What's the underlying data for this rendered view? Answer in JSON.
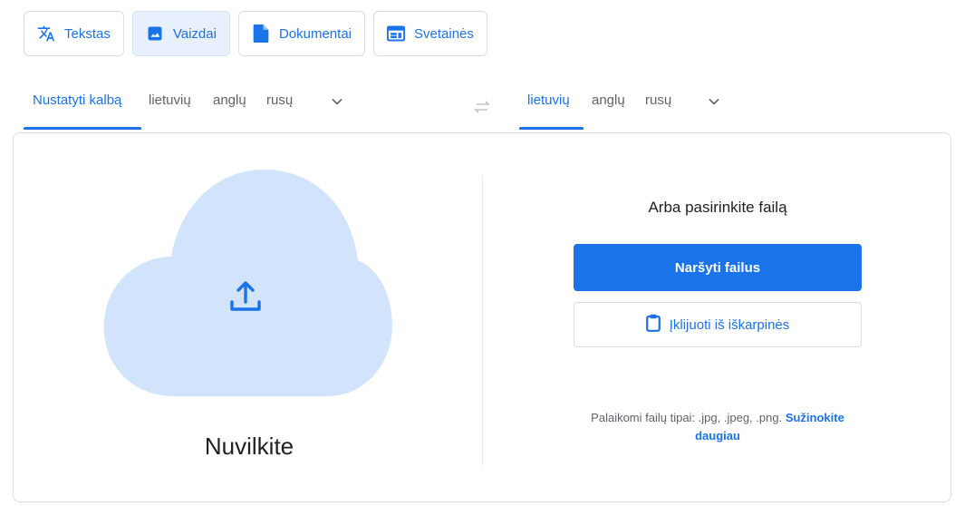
{
  "modes": {
    "text": "Tekstas",
    "images": "Vaizdai",
    "documents": "Dokumentai",
    "websites": "Svetainės",
    "active": "images"
  },
  "source_langs": {
    "detect": "Nustatyti kalbą",
    "lang1": "lietuvių",
    "lang2": "anglų",
    "lang3": "rusų"
  },
  "target_langs": {
    "lang1": "lietuvių",
    "lang2": "anglų",
    "lang3": "rusų"
  },
  "upload": {
    "drop_text": "Nuvilkite",
    "or_choose": "Arba pasirinkite failą",
    "browse_label": "Naršyti failus",
    "paste_label": "Įklijuoti iš iškarpinės",
    "supported_prefix": "Palaikomi failų tipai: .jpg, .jpeg, .png.",
    "learn_more": "Sužinokite daugiau"
  },
  "colors": {
    "accent": "#1a73e8",
    "cloud": "#d2e3fc",
    "active_chip_bg": "#e8f0fe"
  },
  "icons": {
    "text": "translate-icon",
    "images": "image-icon",
    "documents": "document-icon",
    "websites": "website-icon",
    "upload": "upload-icon",
    "paste": "clipboard-icon",
    "swap": "swap-icon",
    "more": "chevron-down-icon"
  }
}
